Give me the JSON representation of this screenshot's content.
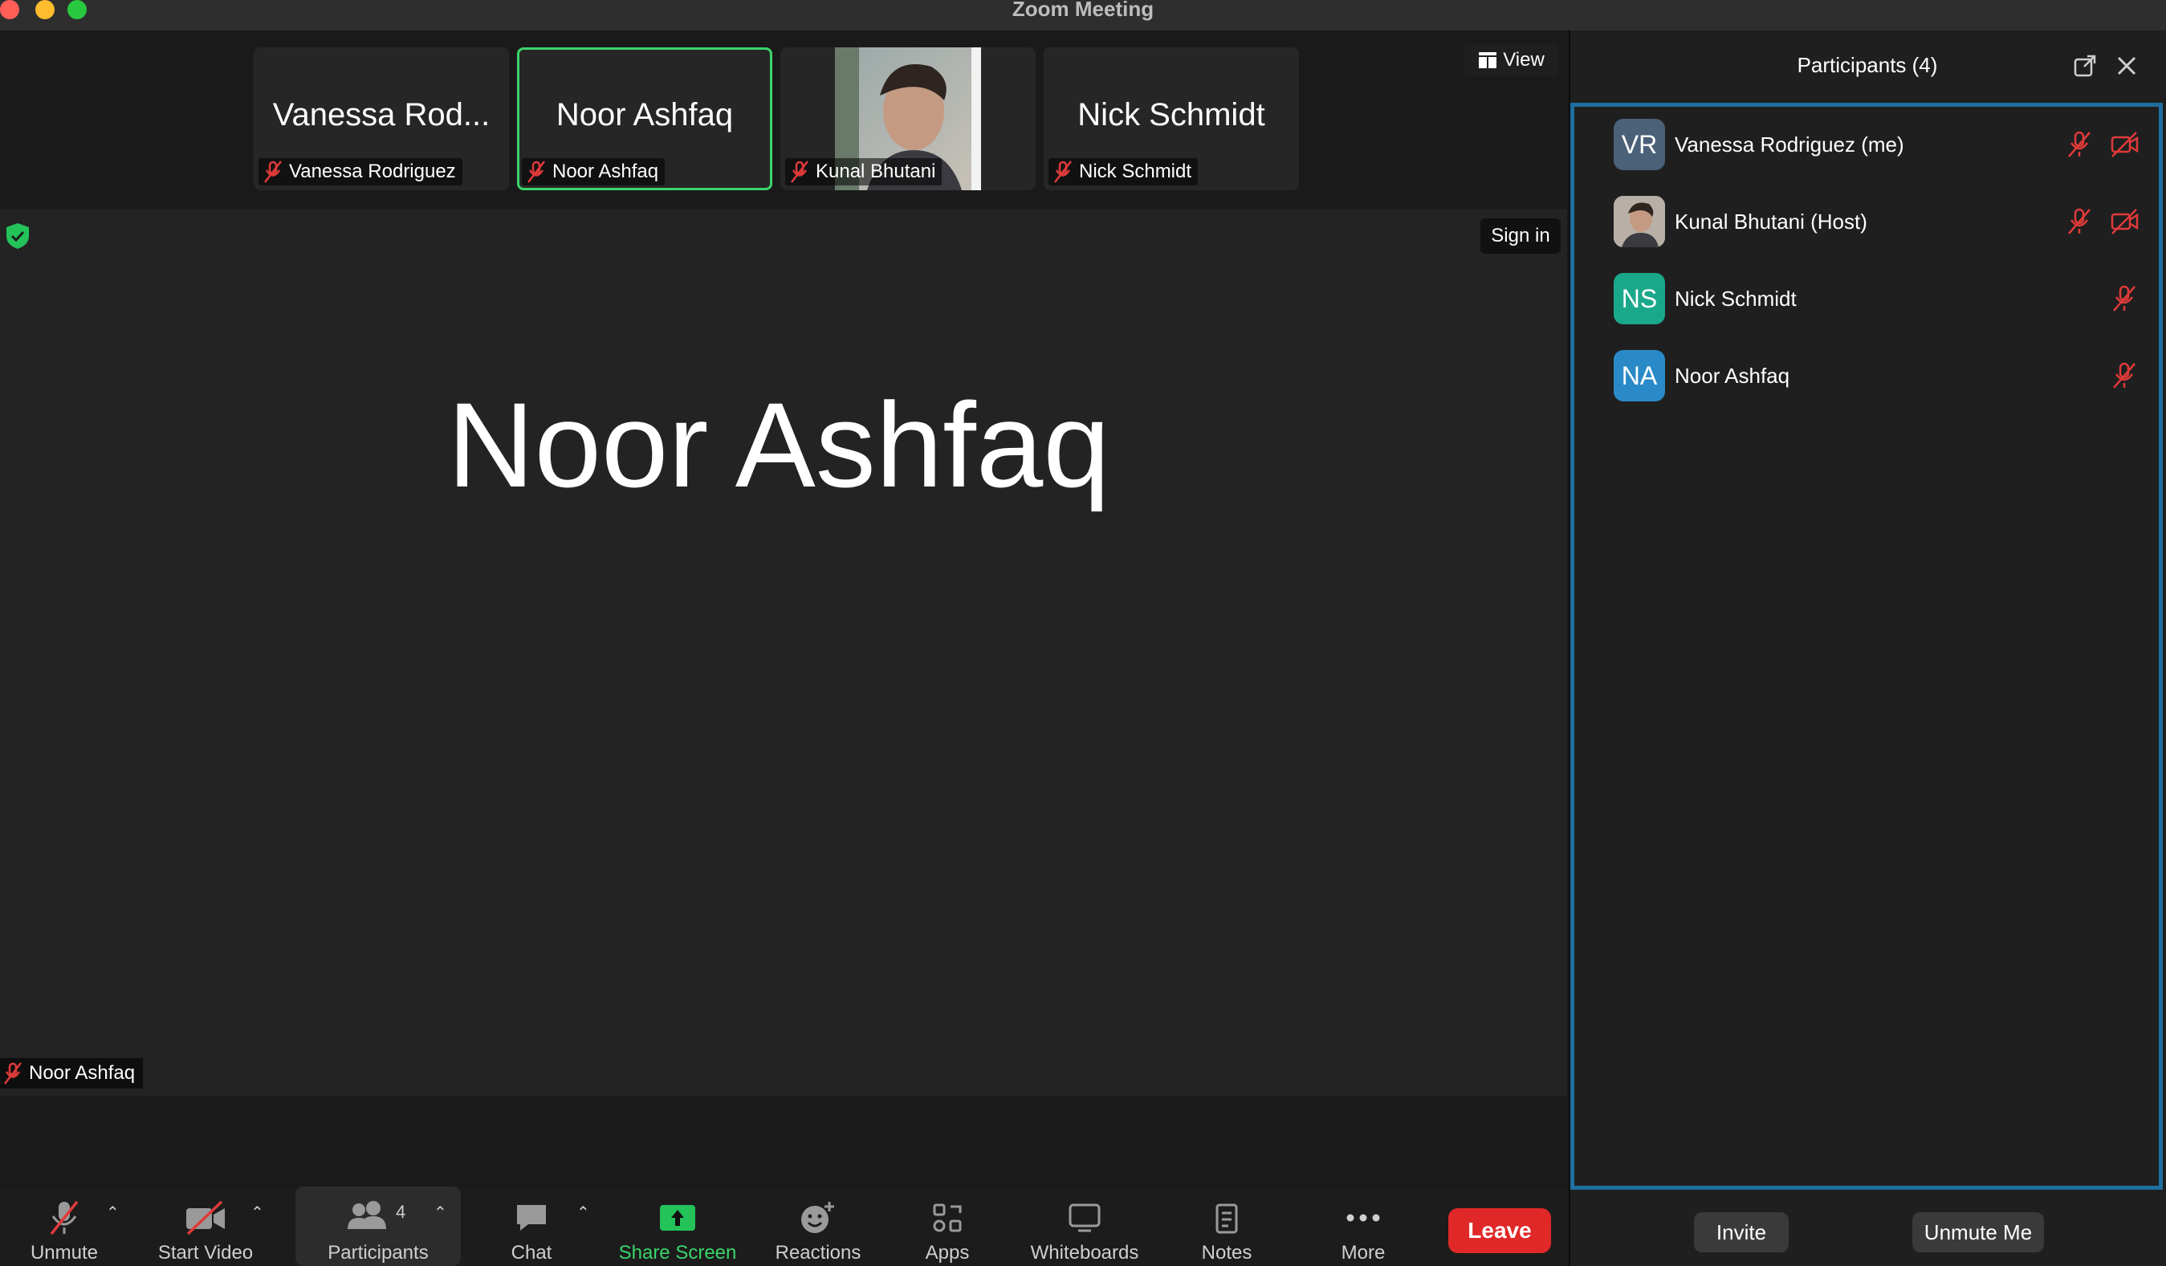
{
  "window": {
    "title": "Zoom Meeting"
  },
  "thumbnails": [
    {
      "display_name": "Vanessa Rod...",
      "label": "Vanessa Rodriguez"
    },
    {
      "display_name": "Noor Ashfaq",
      "label": "Noor Ashfaq"
    },
    {
      "label": "Kunal Bhutani"
    },
    {
      "display_name": "Nick Schmidt",
      "label": "Nick Schmidt"
    }
  ],
  "stage": {
    "speaker_name": "Noor Ashfaq",
    "label": "Noor Ashfaq"
  },
  "view_button": "View",
  "sign_in_button": "Sign in",
  "toolbar": {
    "unmute": "Unmute",
    "start_video": "Start Video",
    "participants": "Participants",
    "participants_count": "4",
    "chat": "Chat",
    "share_screen": "Share Screen",
    "reactions": "Reactions",
    "apps": "Apps",
    "whiteboards": "Whiteboards",
    "notes": "Notes",
    "more": "More",
    "leave": "Leave"
  },
  "panel": {
    "title": "Participants (4)",
    "participants": [
      {
        "initials": "VR",
        "name": "Vanessa Rodriguez (me)",
        "avatar_color": "#4a6178"
      },
      {
        "initials": "",
        "name": "Kunal Bhutani (Host)",
        "avatar_color": "#8a7a6a"
      },
      {
        "initials": "NS",
        "name": "Nick Schmidt",
        "avatar_color": "#1aa88a"
      },
      {
        "initials": "NA",
        "name": "Noor Ashfaq",
        "avatar_color": "#2a8ac8"
      }
    ],
    "invite_button": "Invite",
    "unmute_me_button": "Unmute Me"
  },
  "colors": {
    "accent_green": "#3ad56a",
    "leave_red": "#e02828",
    "muted_red": "#e03a3a",
    "panel_border": "#1f6fa0"
  }
}
